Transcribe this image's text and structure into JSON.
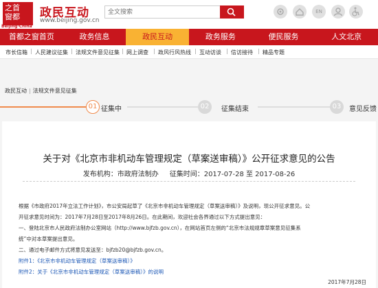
{
  "header": {
    "logo_row1": "之首",
    "logo_row2": "窗都",
    "logo_sub": "Beijing·China",
    "site_title": "政民互动",
    "site_url": "www.beijing.gov.cn",
    "search_placeholder": "全文搜索",
    "icons": [
      "gear-icon",
      "home-icon",
      "en-icon",
      "user-icon",
      "accessibility-icon"
    ],
    "icon_en": "EN"
  },
  "nav": {
    "items": [
      "首都之窗首页",
      "政务信息",
      "政民互动",
      "政务服务",
      "便民服务",
      "人文北京"
    ],
    "active_index": 2
  },
  "subnav": {
    "items": [
      "市长信箱",
      "人民建议征集",
      "法规文件意见征集",
      "网上调查",
      "政风行风热线",
      "互动访谈",
      "信访接待",
      "精品专题"
    ]
  },
  "breadcrumb": [
    "政民互动",
    "法规文件意见征集"
  ],
  "progress": {
    "steps": [
      {
        "num": "01",
        "label": "征集中"
      },
      {
        "num": "02",
        "label": "征集结束"
      },
      {
        "num": "03",
        "label": "意见反馈"
      }
    ],
    "current": 1
  },
  "article": {
    "title": "关于对《北京市非机动车管理规定（草案送审稿）》公开征求意见的公告",
    "publisher": "发布机构：市政府法制办",
    "period": "征集时间：2017-07-28 至 2017-08-26",
    "para1": "根据《市政府2017年立法工作计划》，市公安局起草了《北京市非机动车管理规定（草案送审稿）》及说明，现公开征求意见。公",
    "para1b": "开征求意见时间为：2017年7月28日至2017年8月26日。在此期间，欢迎社会各界通过以下方式提出意见：",
    "para2": "一、登陆北京市人民政府法制办公室网站（http://www.bjfzb.gov.cn），在网站首页左侧的“北京市法规规章草案意见征集系",
    "para2b": "统”中对本草案提出意见。",
    "para3": "二、通过电子邮件方式将意见发送至：bjfzb20@bjfzb.gov.cn。",
    "attach1": "附件1：《北京市非机动车管理规定（草案送审稿）》",
    "attach2": "附件2：关于《北京市非机动车管理规定（草案送审稿）》的说明",
    "date": "2017年7月28日"
  }
}
